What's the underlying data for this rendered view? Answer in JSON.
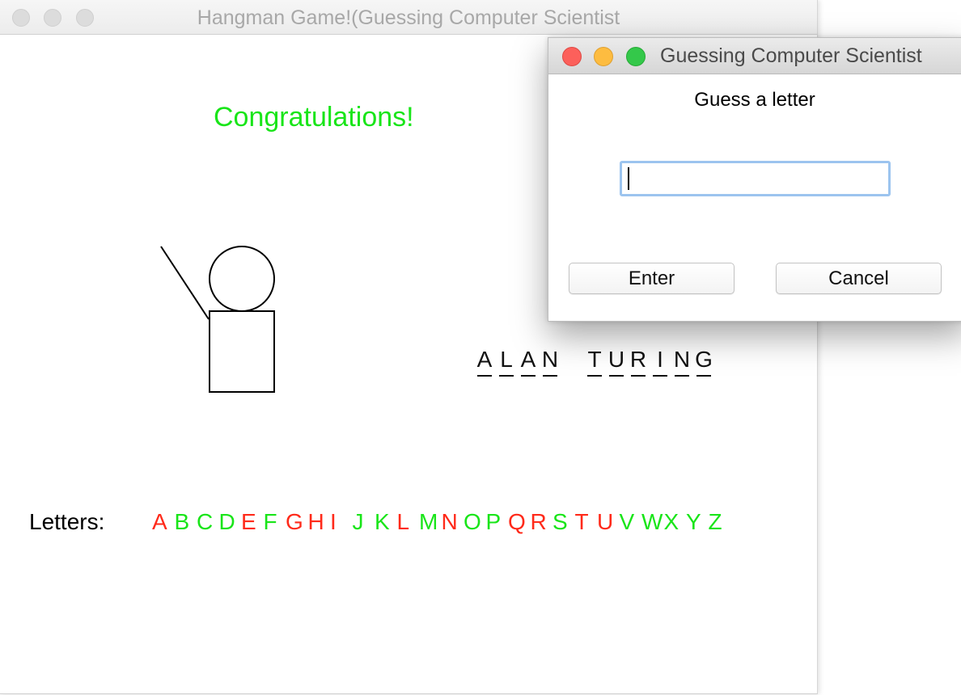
{
  "main_window": {
    "title": "Hangman Game!(Guessing Computer Scientist",
    "message": "Congratulations!",
    "message_color": "#19e519",
    "word_letters": [
      "A",
      "L",
      "A",
      "N",
      " ",
      "T",
      "U",
      "R",
      "I",
      "N",
      "G"
    ],
    "letters_label": "Letters:",
    "alphabet": [
      {
        "letter": "A",
        "used": true
      },
      {
        "letter": "B",
        "used": false
      },
      {
        "letter": "C",
        "used": false
      },
      {
        "letter": "D",
        "used": false
      },
      {
        "letter": "E",
        "used": true
      },
      {
        "letter": "F",
        "used": false
      },
      {
        "letter": "G",
        "used": true
      },
      {
        "letter": "H",
        "used": true
      },
      {
        "letter": "I",
        "used": true
      },
      {
        "letter": "J",
        "used": false
      },
      {
        "letter": "K",
        "used": false
      },
      {
        "letter": "L",
        "used": true
      },
      {
        "letter": "M",
        "used": false
      },
      {
        "letter": "N",
        "used": true
      },
      {
        "letter": "O",
        "used": false
      },
      {
        "letter": "P",
        "used": false
      },
      {
        "letter": "Q",
        "used": true
      },
      {
        "letter": "R",
        "used": true
      },
      {
        "letter": "S",
        "used": false
      },
      {
        "letter": "T",
        "used": true
      },
      {
        "letter": "U",
        "used": true
      },
      {
        "letter": "V",
        "used": false
      },
      {
        "letter": "W",
        "used": false
      },
      {
        "letter": "X",
        "used": false
      },
      {
        "letter": "Y",
        "used": false
      },
      {
        "letter": "Z",
        "used": false
      }
    ],
    "used_color": "#ff2a1a",
    "unused_color": "#19e519"
  },
  "dialog": {
    "title": "Guessing Computer Scientist",
    "prompt": "Guess a letter",
    "input_value": "",
    "enter_label": "Enter",
    "cancel_label": "Cancel"
  }
}
